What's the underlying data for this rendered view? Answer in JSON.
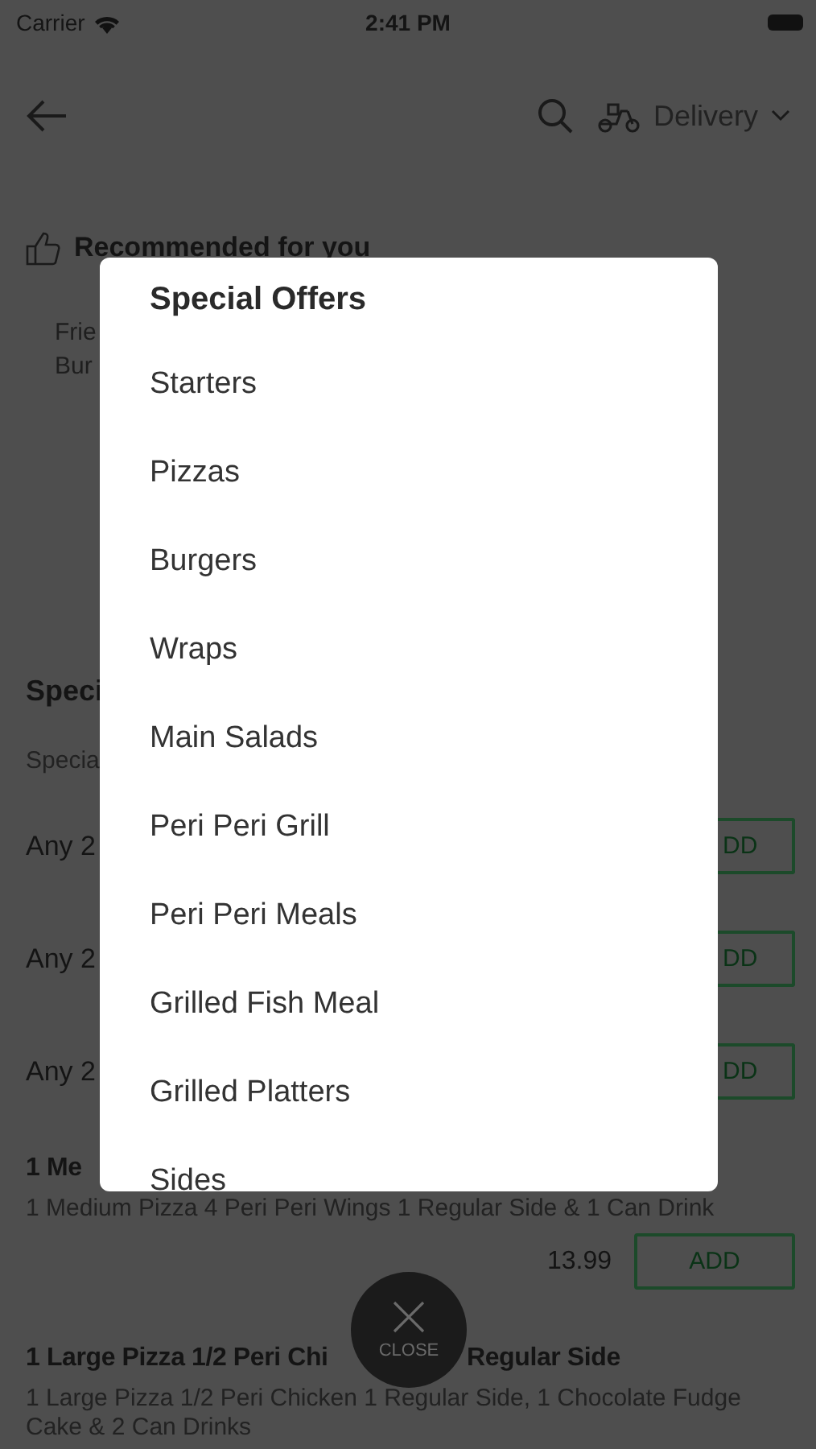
{
  "status_bar": {
    "carrier": "Carrier",
    "time": "2:41 PM"
  },
  "header": {
    "delivery_label": "Delivery"
  },
  "recommended": {
    "title": "Recommended for you",
    "items": [
      "Frie",
      "Bur"
    ]
  },
  "section": {
    "title": "Speci",
    "subtitle": "Specia"
  },
  "offers": [
    {
      "name": "Any 2",
      "button": "DD"
    },
    {
      "name": "Any 2",
      "button": "DD"
    },
    {
      "name": "Any 2",
      "button": "DD"
    }
  ],
  "products": [
    {
      "name_parts": [
        "1 Me"
      ],
      "description": "1 Medium Pizza 4 Peri Peri Wings 1 Regular Side & 1 Can Drink",
      "price": "13.99",
      "button": "ADD"
    },
    {
      "name_parts": [
        "1 Large Pizza 1/2 Peri Chi",
        "Regular Side"
      ],
      "description": "1 Large Pizza 1/2 Peri Chicken 1 Regular Side, 1 Chocolate Fudge Cake & 2 Can Drinks"
    }
  ],
  "menu": {
    "title": "Special Offers",
    "items": [
      "Starters",
      "Pizzas",
      "Burgers",
      "Wraps",
      "Main Salads",
      "Peri Peri Grill",
      "Peri Peri Meals",
      "Grilled Fish Meal",
      "Grilled Platters",
      "Sides"
    ]
  },
  "close_button": {
    "label": "CLOSE"
  }
}
